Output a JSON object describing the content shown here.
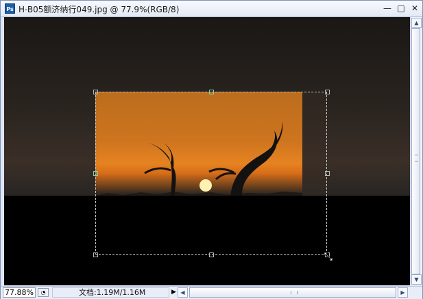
{
  "window": {
    "title": "H-B05额济纳行049.jpg @ 77.9%(RGB/8)",
    "app_icon": "Ps",
    "controls": {
      "minimize": "—",
      "maximize": "□",
      "close": "✕"
    }
  },
  "canvas": {
    "description_icons": [
      "crop-handle",
      "resize-cursor-icon"
    ]
  },
  "statusbar": {
    "zoom": "77.88%",
    "doc_info": "文档:1.19M/1.16M",
    "play_icon": "▶"
  },
  "scrollbars": {
    "vertical_up": "▲",
    "vertical_down": "▼",
    "horizontal_left": "◀",
    "horizontal_right": "▶"
  },
  "colors": {
    "sunset": "#d77d22",
    "sun": "#fff2b0",
    "ps_blue": "#1b5ea9"
  }
}
